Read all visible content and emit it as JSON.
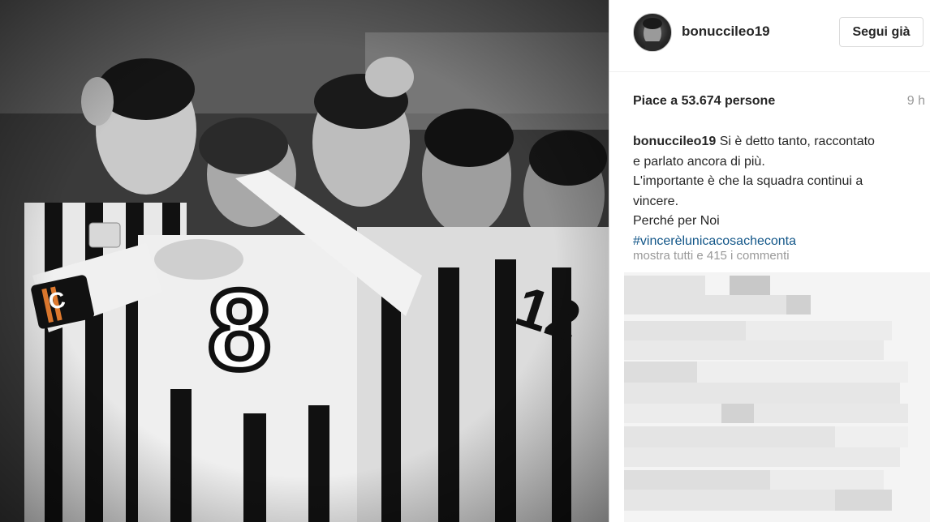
{
  "post": {
    "username": "bonucci​leo19",
    "follow_label": "Segui già",
    "likes_text": "Piace a 53.674 persone",
    "time_ago": "9 h",
    "caption_username": "bonucci​leo19",
    "caption_lines": [
      "Si è detto tanto, raccontato",
      "e parlato ancora di più.",
      "L'importante è che la squadra continui a",
      "vincere.",
      "Perché per Noi"
    ],
    "hashtag": "#vincerèlunicacosachecont­a",
    "view_all_comments": "mostra tutti e 415 i commenti"
  },
  "photo": {
    "jersey_number_front": "8",
    "jersey_number_right": "12",
    "armband_letter": "C"
  }
}
